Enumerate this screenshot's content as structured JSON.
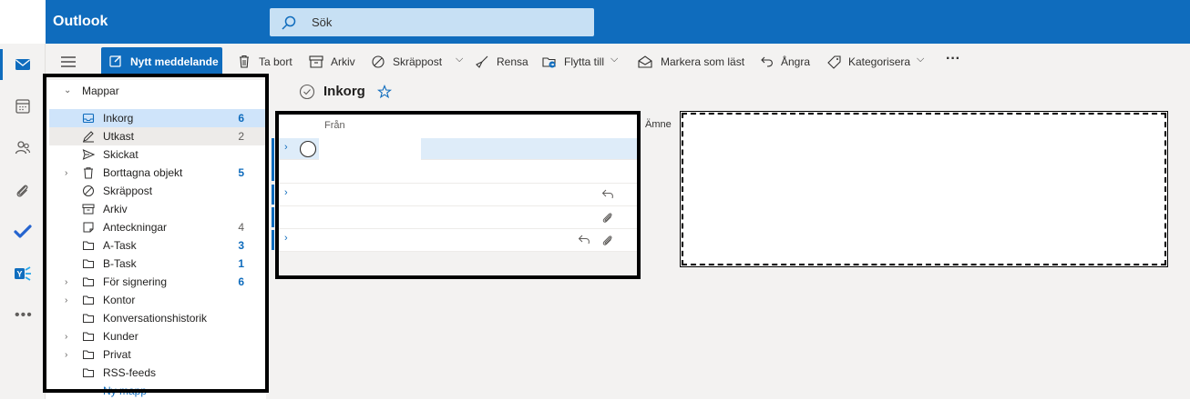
{
  "app": {
    "title": "Outlook"
  },
  "search": {
    "placeholder": "Sök"
  },
  "toolbar": {
    "new_message": "Nytt meddelande",
    "delete": "Ta bort",
    "archive": "Arkiv",
    "junk": "Skräppost",
    "sweep": "Rensa",
    "move_to": "Flytta till",
    "mark_read": "Markera som läst",
    "undo": "Ångra",
    "categorize": "Kategorisera",
    "more": "···"
  },
  "folders": {
    "header": "Mappar",
    "items": [
      {
        "name": "Inkorg",
        "count": "6",
        "icon": "inbox-icon",
        "selected": true,
        "expandable": false,
        "count_style": "blue"
      },
      {
        "name": "Utkast",
        "count": "2",
        "icon": "drafts-icon",
        "selected": false,
        "expandable": false,
        "count_style": "gray"
      },
      {
        "name": "Skickat",
        "count": "",
        "icon": "sent-icon",
        "expandable": false
      },
      {
        "name": "Borttagna objekt",
        "count": "5",
        "icon": "trash-icon",
        "expandable": true,
        "count_style": "blue"
      },
      {
        "name": "Skräppost",
        "count": "",
        "icon": "junk-icon",
        "expandable": false
      },
      {
        "name": "Arkiv",
        "count": "",
        "icon": "archive-icon",
        "expandable": false
      },
      {
        "name": "Anteckningar",
        "count": "4",
        "icon": "notes-icon",
        "expandable": false,
        "count_style": "gray"
      },
      {
        "name": "A-Task",
        "count": "3",
        "icon": "folder-icon",
        "expandable": false,
        "count_style": "blue"
      },
      {
        "name": "B-Task",
        "count": "1",
        "icon": "folder-icon",
        "expandable": false,
        "count_style": "blue"
      },
      {
        "name": "För signering",
        "count": "6",
        "icon": "folder-icon",
        "expandable": true,
        "count_style": "blue"
      },
      {
        "name": "Kontor",
        "count": "",
        "icon": "folder-icon",
        "expandable": true
      },
      {
        "name": "Konversationshistorik",
        "count": "",
        "icon": "folder-icon",
        "expandable": false
      },
      {
        "name": "Kunder",
        "count": "",
        "icon": "folder-icon",
        "expandable": true
      },
      {
        "name": "Privat",
        "count": "",
        "icon": "folder-icon",
        "expandable": true
      },
      {
        "name": "RSS-feeds",
        "count": "",
        "icon": "folder-icon",
        "expandable": false
      }
    ],
    "new_folder": "Ny mapp"
  },
  "mail": {
    "folder_title": "Inkorg",
    "col_from": "Från",
    "col_subject": "Ämne"
  },
  "colors": {
    "accent": "#0f6cbd",
    "selected": "#cfe4fa",
    "search_bg": "#c7e0f4"
  }
}
